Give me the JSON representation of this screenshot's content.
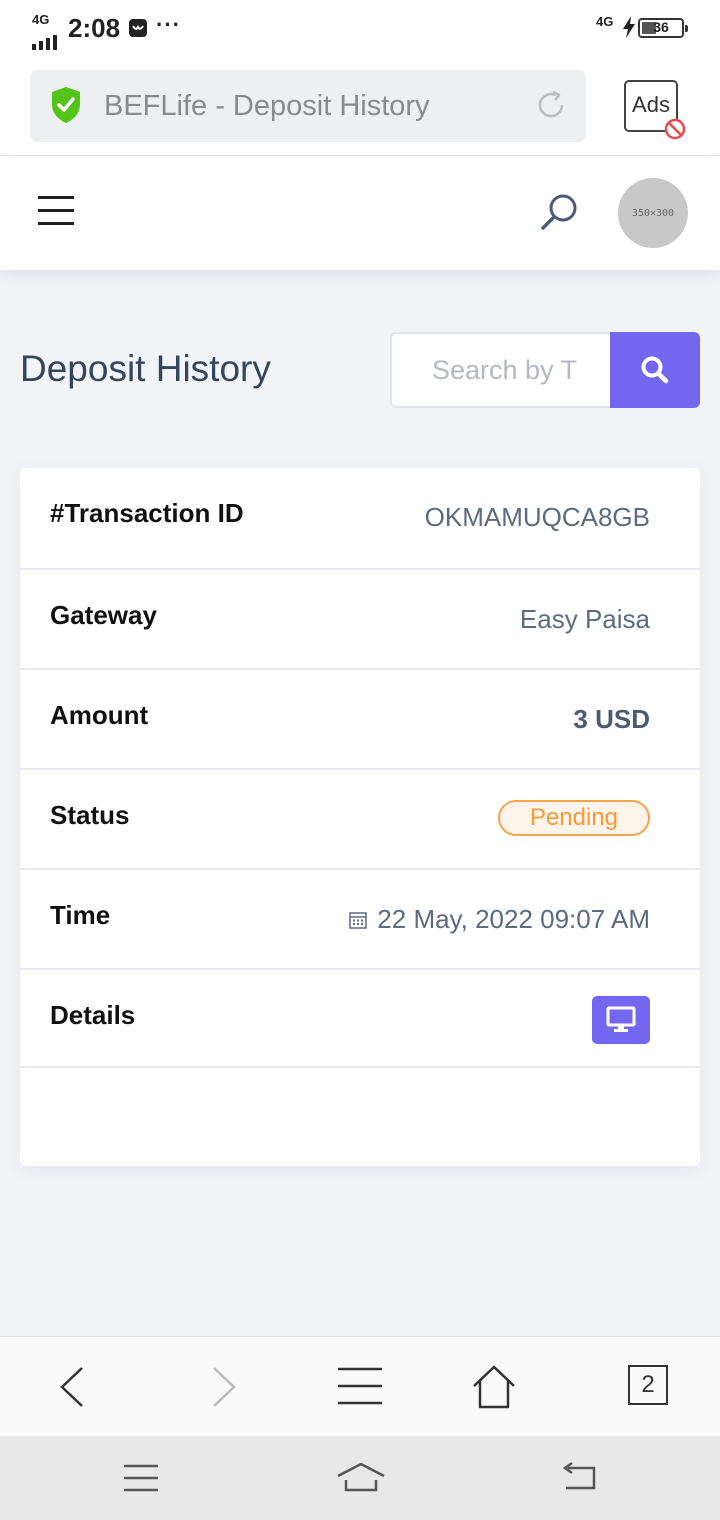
{
  "status_bar": {
    "network_left": "4G",
    "time": "2:08",
    "network_right": "4G",
    "battery": "36"
  },
  "browser": {
    "page_title": "BEFLife - Deposit History",
    "ads_label": "Ads",
    "tab_count": "2"
  },
  "header": {
    "avatar_placeholder": "350×300"
  },
  "page": {
    "title": "Deposit History",
    "search_placeholder": "Search by T"
  },
  "deposit": {
    "rows": [
      {
        "label": "#Transaction ID",
        "value": "OKMAMUQCA8GB"
      },
      {
        "label": "Gateway",
        "value": "Easy Paisa"
      },
      {
        "label": "Amount",
        "value": "3 USD"
      },
      {
        "label": "Status",
        "value": "Pending"
      },
      {
        "label": "Time",
        "value": "22 May, 2022 09:07 AM"
      },
      {
        "label": "Details",
        "value": ""
      }
    ]
  },
  "colors": {
    "accent": "#7367f0",
    "pending": "#f29a3c",
    "shield": "#52c41a"
  }
}
